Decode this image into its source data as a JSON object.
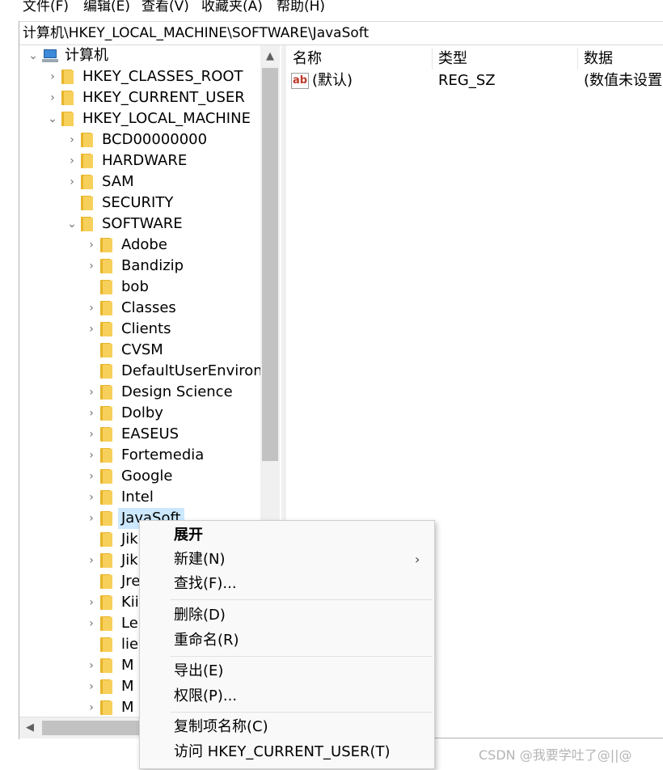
{
  "menubar": {
    "items": [
      "文件(F)",
      "编辑(E)",
      "查看(V)",
      "收藏夹(A)",
      "帮助(H)"
    ]
  },
  "address": {
    "path": "计算机\\HKEY_LOCAL_MACHINE\\SOFTWARE\\JavaSoft"
  },
  "tree": {
    "root": "计算机",
    "nodes": [
      {
        "label": "HKEY_CLASSES_ROOT",
        "arrow": "›"
      },
      {
        "label": "HKEY_CURRENT_USER",
        "arrow": "›"
      },
      {
        "label": "HKEY_LOCAL_MACHINE",
        "arrow": "⌄"
      },
      {
        "label": "BCD00000000",
        "arrow": "›"
      },
      {
        "label": "HARDWARE",
        "arrow": "›"
      },
      {
        "label": "SAM",
        "arrow": "›"
      },
      {
        "label": "SECURITY",
        "arrow": ""
      },
      {
        "label": "SOFTWARE",
        "arrow": "⌄"
      },
      {
        "label": "Adobe",
        "arrow": "›"
      },
      {
        "label": "Bandizip",
        "arrow": "›"
      },
      {
        "label": "bob",
        "arrow": ""
      },
      {
        "label": "Classes",
        "arrow": "›"
      },
      {
        "label": "Clients",
        "arrow": "›"
      },
      {
        "label": "CVSM",
        "arrow": ""
      },
      {
        "label": "DefaultUserEnviron",
        "arrow": ""
      },
      {
        "label": "Design Science",
        "arrow": "›"
      },
      {
        "label": "Dolby",
        "arrow": "›"
      },
      {
        "label": "EASEUS",
        "arrow": "›"
      },
      {
        "label": "Fortemedia",
        "arrow": "›"
      },
      {
        "label": "Google",
        "arrow": "›"
      },
      {
        "label": "Intel",
        "arrow": "›"
      },
      {
        "label": "JavaSoft",
        "arrow": "›"
      },
      {
        "label": "Jik",
        "arrow": ""
      },
      {
        "label": "Jik",
        "arrow": "›"
      },
      {
        "label": "Jre",
        "arrow": ""
      },
      {
        "label": "Kii",
        "arrow": "›"
      },
      {
        "label": "Le",
        "arrow": "›"
      },
      {
        "label": "lie",
        "arrow": ""
      },
      {
        "label": "M",
        "arrow": "›"
      },
      {
        "label": "M",
        "arrow": "›"
      },
      {
        "label": "M",
        "arrow": "›"
      }
    ]
  },
  "list": {
    "headers": [
      "名称",
      "类型",
      "数据"
    ],
    "rows": [
      {
        "name": "(默认)",
        "type": "REG_SZ",
        "data": "(数值未设置)"
      }
    ]
  },
  "context_menu": {
    "items": [
      {
        "label": "展开",
        "bold": true
      },
      {
        "label": "新建(N)",
        "submenu": true
      },
      {
        "label": "查找(F)..."
      },
      {
        "label": "删除(D)"
      },
      {
        "label": "重命名(R)"
      },
      {
        "label": "导出(E)"
      },
      {
        "label": "权限(P)..."
      },
      {
        "label": "复制项名称(C)"
      },
      {
        "label": "访问 HKEY_CURRENT_USER(T)"
      }
    ],
    "submenu_arrow": "›"
  },
  "watermark": "CSDN @我要学吐了@||@",
  "icons": {
    "tree_root": "computer-icon",
    "folder": "folder-icon",
    "value": "string-value-icon",
    "value_glyph": "ab"
  },
  "colors": {
    "selection": "#cce8ff",
    "folder": "#f7d05b"
  }
}
